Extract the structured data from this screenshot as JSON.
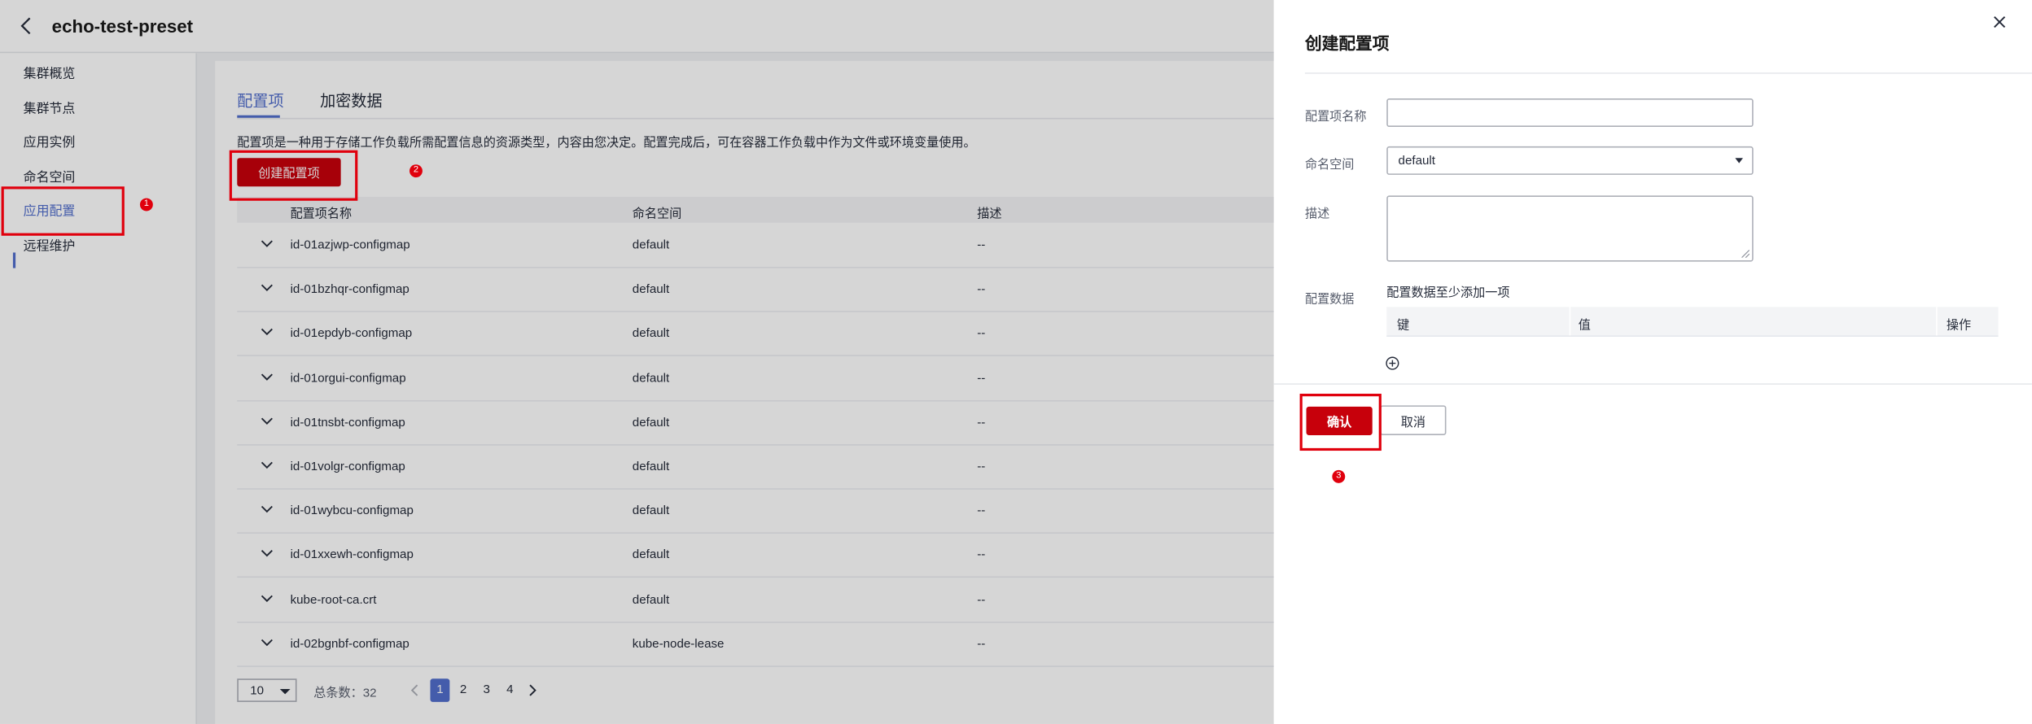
{
  "header": {
    "title": "echo-test-preset"
  },
  "sidebar": {
    "items": [
      {
        "label": "集群概览"
      },
      {
        "label": "集群节点"
      },
      {
        "label": "应用实例"
      },
      {
        "label": "命名空间"
      },
      {
        "label": "应用配置"
      },
      {
        "label": "远程维护"
      }
    ],
    "active_index": 4
  },
  "main": {
    "tabs": [
      {
        "label": "配置项"
      },
      {
        "label": "加密数据"
      }
    ],
    "description": "配置项是一种用于存储工作负载所需配置信息的资源类型，内容由您决定。配置完成后，可在容器工作负载中作为文件或环境变量使用。",
    "create_button": "创建配置项",
    "table": {
      "headers": [
        "配置项名称",
        "命名空间",
        "描述"
      ],
      "rows": [
        {
          "name": "id-01azjwp-configmap",
          "namespace": "default",
          "desc": "--"
        },
        {
          "name": "id-01bzhqr-configmap",
          "namespace": "default",
          "desc": "--"
        },
        {
          "name": "id-01epdyb-configmap",
          "namespace": "default",
          "desc": "--"
        },
        {
          "name": "id-01orgui-configmap",
          "namespace": "default",
          "desc": "--"
        },
        {
          "name": "id-01tnsbt-configmap",
          "namespace": "default",
          "desc": "--"
        },
        {
          "name": "id-01volgr-configmap",
          "namespace": "default",
          "desc": "--"
        },
        {
          "name": "id-01wybcu-configmap",
          "namespace": "default",
          "desc": "--"
        },
        {
          "name": "id-01xxewh-configmap",
          "namespace": "default",
          "desc": "--"
        },
        {
          "name": "kube-root-ca.crt",
          "namespace": "default",
          "desc": "--"
        },
        {
          "name": "id-02bgnbf-configmap",
          "namespace": "kube-node-lease",
          "desc": "--"
        }
      ]
    },
    "pagination": {
      "page_size": "10",
      "total": "总条数：32",
      "pages": [
        "1",
        "2",
        "3",
        "4"
      ],
      "current": "1"
    }
  },
  "drawer": {
    "title": "创建配置项",
    "fields": {
      "name_label": "配置项名称",
      "name_value": "",
      "namespace_label": "命名空间",
      "namespace_value": "default",
      "desc_label": "描述",
      "desc_value": "",
      "data_label": "配置数据",
      "data_hint": "配置数据至少添加一项"
    },
    "kv_headers": [
      "键",
      "值",
      "操作"
    ],
    "confirm_button": "确认",
    "cancel_button": "取消"
  },
  "annotations": {
    "steps": [
      "1",
      "2",
      "3"
    ]
  },
  "colors": {
    "accent": "#526ecc",
    "primary_button": "#c7000b",
    "annotation": "#e0000d"
  }
}
